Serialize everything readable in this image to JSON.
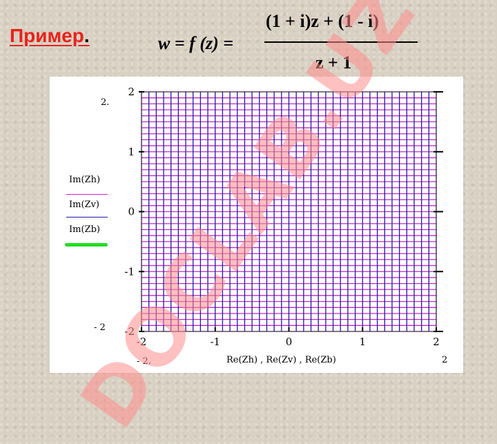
{
  "slide": {
    "title": "Пример",
    "title_dot": ".",
    "formula": {
      "lhs": "w = f (z) =",
      "numerator": "(1 + i)z + (1 - i)",
      "denominator": "z + 1"
    }
  },
  "chart_data": {
    "type": "line",
    "xlim": [
      -2,
      2
    ],
    "ylim": [
      -2,
      2
    ],
    "x_ticks": [
      "-2",
      "-1",
      "0",
      "1",
      "2"
    ],
    "y_ticks": [
      "2",
      "1",
      "0",
      "-1",
      "-2"
    ],
    "outer_x_min": "- 2.",
    "outer_x_max": "2",
    "outer_y_max": "2.",
    "outer_y_min": "- 2",
    "xlabel": "Re(Zh) , Re(Zv) , Re(Zb)",
    "legend_placement": "left",
    "series": [
      {
        "name": "Im(Zh)",
        "color": "#cc22cc",
        "kind": "horizontal lines",
        "y_values": [
          -2,
          -1.9,
          -1.8,
          -1.7,
          -1.6,
          -1.5,
          -1.4,
          -1.3,
          -1.2,
          -1.1,
          -1,
          -0.9,
          -0.8,
          -0.7,
          -0.6,
          -0.5,
          -0.4,
          -0.3,
          -0.2,
          -0.1,
          0,
          0.1,
          0.2,
          0.3,
          0.4,
          0.5,
          0.6,
          0.7,
          0.8,
          0.9,
          1,
          1.1,
          1.2,
          1.3,
          1.4,
          1.5,
          1.6,
          1.7,
          1.8,
          1.9,
          2
        ]
      },
      {
        "name": "Im(Zv)",
        "color": "#1a1aa6",
        "kind": "vertical lines",
        "x_values": [
          -2,
          -1.9,
          -1.8,
          -1.7,
          -1.6,
          -1.5,
          -1.4,
          -1.3,
          -1.2,
          -1.1,
          -1,
          -0.9,
          -0.8,
          -0.7,
          -0.6,
          -0.5,
          -0.4,
          -0.3,
          -0.2,
          -0.1,
          0,
          0.1,
          0.2,
          0.3,
          0.4,
          0.5,
          0.6,
          0.7,
          0.8,
          0.9,
          1,
          1.1,
          1.2,
          1.3,
          1.4,
          1.5,
          1.6,
          1.7,
          1.8,
          1.9,
          2
        ]
      },
      {
        "name": "Im(Zb)",
        "color": "#22dd22",
        "kind": "boundary",
        "values": []
      }
    ],
    "grid": true
  },
  "watermark": "DOCLAB.UZ"
}
